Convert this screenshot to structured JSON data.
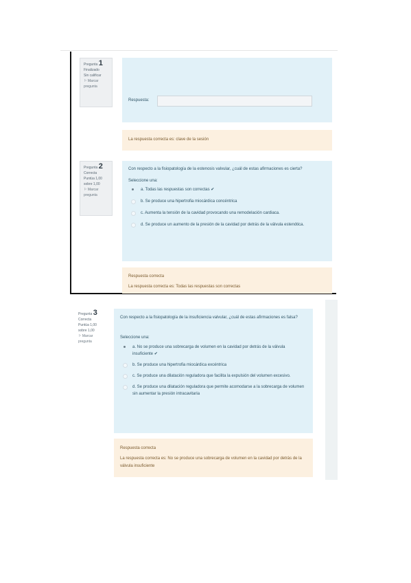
{
  "q1": {
    "label": "Pregunta",
    "number": "1",
    "status": "Finalizado",
    "grade": "Sin calificar",
    "flag": "Marcar pregunta",
    "answer_label": "Respuesta:",
    "answer_value": "",
    "feedback": "La respuesta correcta es: clave de la sesión"
  },
  "q2": {
    "label": "Pregunta",
    "number": "2",
    "status": "Correcta",
    "grade": "Puntúa 1,00 sobre 1,00",
    "flag": "Marcar pregunta",
    "question": "Con respecto a la fisiopatología de la estenosis valvular, ¿cuál de estas afirmaciones es cierta?",
    "select_label": "Seleccione una:",
    "options": [
      "a. Todas las respuestas son correctas",
      "b. Se produce una hipertrofia miocárdica concéntrica",
      "c. Aumenta la tensión de la cavidad provocando una remodelación cardiaca.",
      "d. Se produce un aumento de la presión de la cavidad por detrás de la válvula estenótica."
    ],
    "selected_index": 0,
    "feedback_title": "Respuesta correcta",
    "feedback": "La respuesta correcta es: Todas las respuestas son correctas"
  },
  "q3": {
    "label": "Pregunta",
    "number": "3",
    "status": "Correcta",
    "grade": "Puntúa 1,00 sobre 1,00",
    "flag": "Marcar pregunta",
    "question": "Con respecto a la fisiopatología de la insuficiencia valvular, ¿cuál de estas afirmaciones es falsa?",
    "select_label": "Seleccione una:",
    "options": [
      "a. No se produce una sobrecarga de volumen en la cavidad por detrás de la válvula insuficiente",
      "b. Se produce una hipertrofia miocárdica excéntrica",
      "c. Se produce una dilatación reguladora que facilita la expulsión del volumen excesivo.",
      "d. Se produce una dilatación reguladora que permite acomodarse a la sobrecarga de volumen sin aumentar la presión intracavitaria"
    ],
    "selected_index": 0,
    "feedback_title": "Respuesta correcta",
    "feedback": "La respuesta correcta es: No se produce una sobrecarga de volumen en la cavidad por detrás de la válvula insuficiente"
  },
  "icons": {
    "flag": "flag-icon",
    "correct": "checkmark-icon"
  },
  "colors": {
    "question_bg": "#e1f1f8",
    "feedback_bg": "#fcf0e0",
    "info_bg": "#eef0f2"
  }
}
